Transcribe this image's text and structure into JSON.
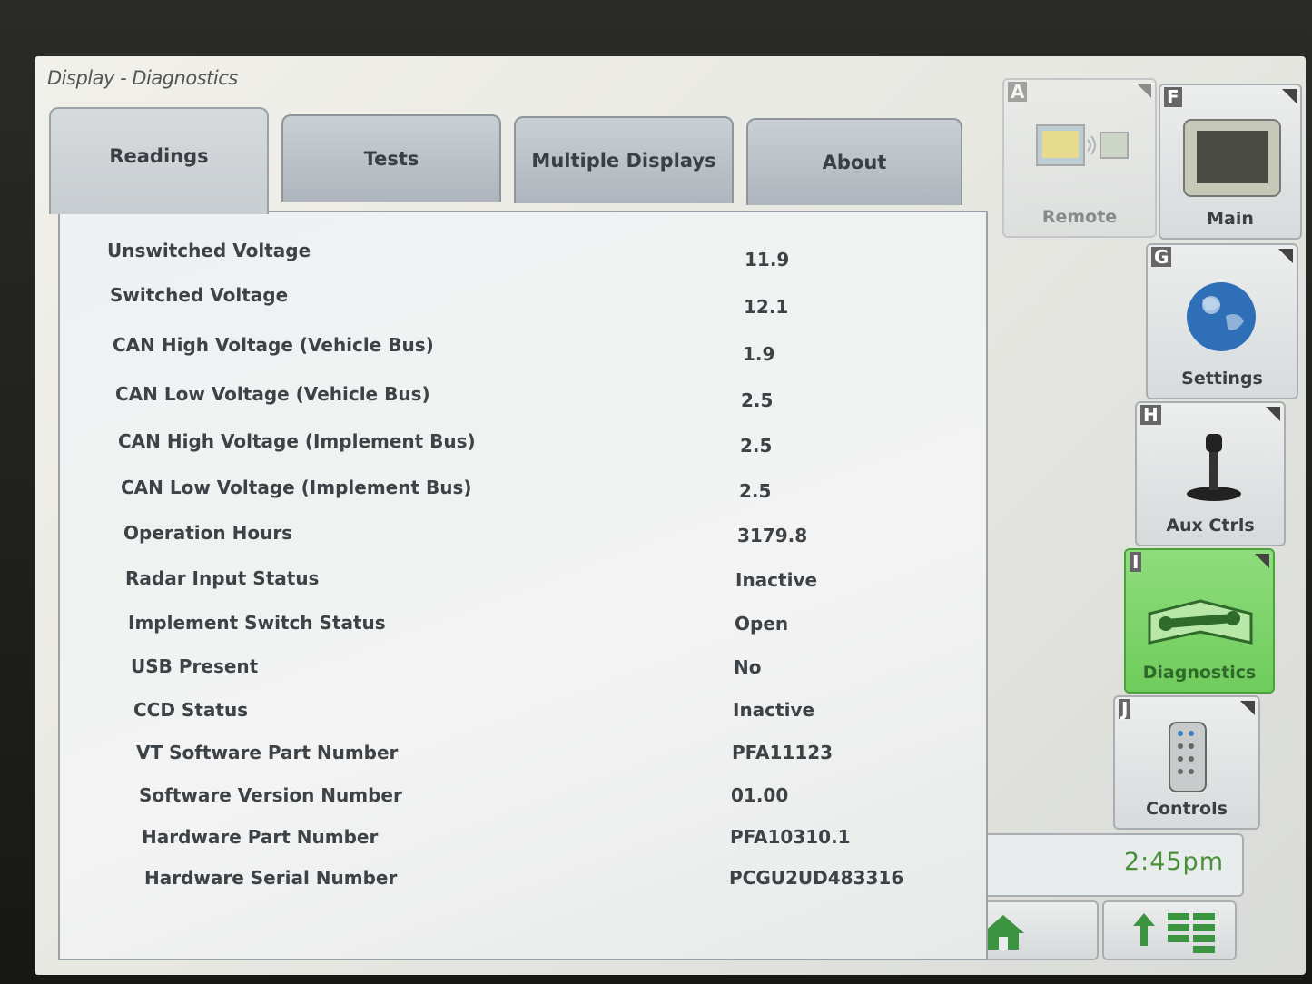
{
  "window": {
    "title": "Display - Diagnostics"
  },
  "tabs": [
    {
      "label": "Readings",
      "active": true
    },
    {
      "label": "Tests",
      "active": false
    },
    {
      "label": "Multiple Displays",
      "active": false
    },
    {
      "label": "About",
      "active": false
    }
  ],
  "readings": [
    {
      "label": "Unswitched Voltage",
      "value": "11.9"
    },
    {
      "label": "Switched Voltage",
      "value": "12.1"
    },
    {
      "label": "CAN High Voltage (Vehicle Bus)",
      "value": "1.9"
    },
    {
      "label": "CAN Low Voltage (Vehicle Bus)",
      "value": "2.5"
    },
    {
      "label": "CAN High Voltage (Implement Bus)",
      "value": "2.5"
    },
    {
      "label": "CAN Low Voltage (Implement Bus)",
      "value": "2.5"
    },
    {
      "label": "Operation Hours",
      "value": "3179.8"
    },
    {
      "label": "Radar Input Status",
      "value": "Inactive"
    },
    {
      "label": "Implement Switch Status",
      "value": "Open"
    },
    {
      "label": "USB Present",
      "value": "No"
    },
    {
      "label": "CCD Status",
      "value": "Inactive"
    },
    {
      "label": "VT Software Part Number",
      "value": "PFA11123"
    },
    {
      "label": "Software Version Number",
      "value": "01.00"
    },
    {
      "label": "Hardware Part Number",
      "value": "PFA10310.1"
    },
    {
      "label": "Hardware Serial Number",
      "value": "PCGU2UD483316"
    }
  ],
  "softkeys": {
    "remote": {
      "letter": "A",
      "label": "Remote",
      "icon": "remote-display-icon"
    },
    "main": {
      "letter": "F",
      "label": "Main",
      "icon": "monitor-icon"
    },
    "settings": {
      "letter": "G",
      "label": "Settings",
      "icon": "globe-icon"
    },
    "aux": {
      "letter": "H",
      "label": "Aux Ctrls",
      "icon": "joystick-icon"
    },
    "diagnostics": {
      "letter": "I",
      "label": "Diagnostics",
      "icon": "wrench-book-icon"
    },
    "controls": {
      "letter": "J",
      "label": "Controls",
      "icon": "remote-control-icon"
    }
  },
  "clock": {
    "time": "2:45pm"
  },
  "nav": {
    "home_icon": "home-icon",
    "menu_icon": "up-arrow-grid-icon"
  },
  "colors": {
    "accent_green": "#6fcc5b",
    "clock_text": "#4a8f3a"
  }
}
